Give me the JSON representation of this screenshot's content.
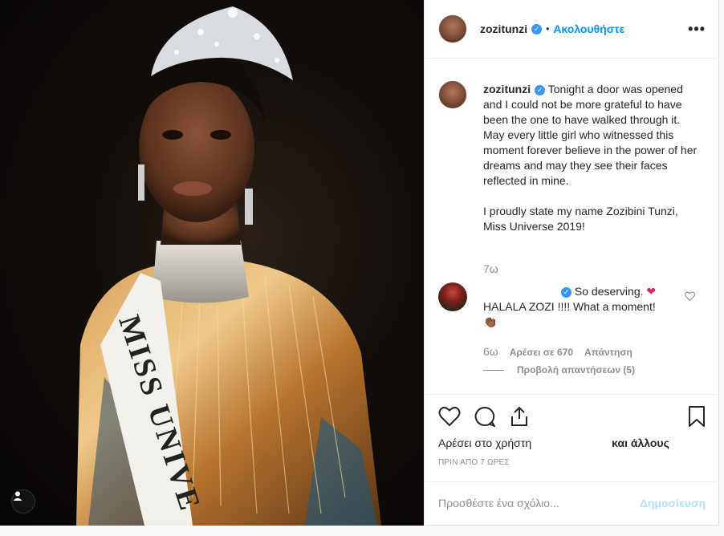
{
  "post": {
    "username": "zozitunzi",
    "follow_label": "Ακολουθήστε",
    "separator": "•",
    "more_label": "•••"
  },
  "caption": {
    "username": "zozitunzi",
    "paragraph1": "Tonight a door was opened and I could not be more grateful to have been the one to have walked through it. May every little girl who witnessed this moment forever believe in the power of her dreams and may they see their faces reflected in mine.",
    "paragraph2": "I proudly state my name Zozibini Tunzi, Miss Universe 2019!",
    "time": "7ω"
  },
  "comment": {
    "text_line1": "So deserving.",
    "emoji1": "❤",
    "text_line2": "HALALA ZOZI !!!! What a moment!",
    "emoji2": "👏🏾",
    "time": "6ω",
    "likes_label": "Αρέσει σε 670",
    "reply_label": "Απάντηση",
    "view_replies_label": "Προβολή απαντήσεων (5)"
  },
  "actions": {
    "liked_by_prefix": "Αρέσει στο χρήστη",
    "liked_by_suffix": "και άλλους",
    "posted_ago": "ΠΡΙΝ ΑΠΟ 7 ΩΡΕΣ"
  },
  "composer": {
    "placeholder": "Προσθέστε ένα σχόλιο...",
    "post_label": "Δημοσίευση"
  },
  "photo": {
    "sash_text": "MISS UNIVE"
  },
  "colors": {
    "accent": "#0095f6",
    "verified": "#3897f0",
    "secondary_text": "#8e8e8e",
    "post_disabled": "#b2dffc",
    "heart": "#e0245e"
  }
}
